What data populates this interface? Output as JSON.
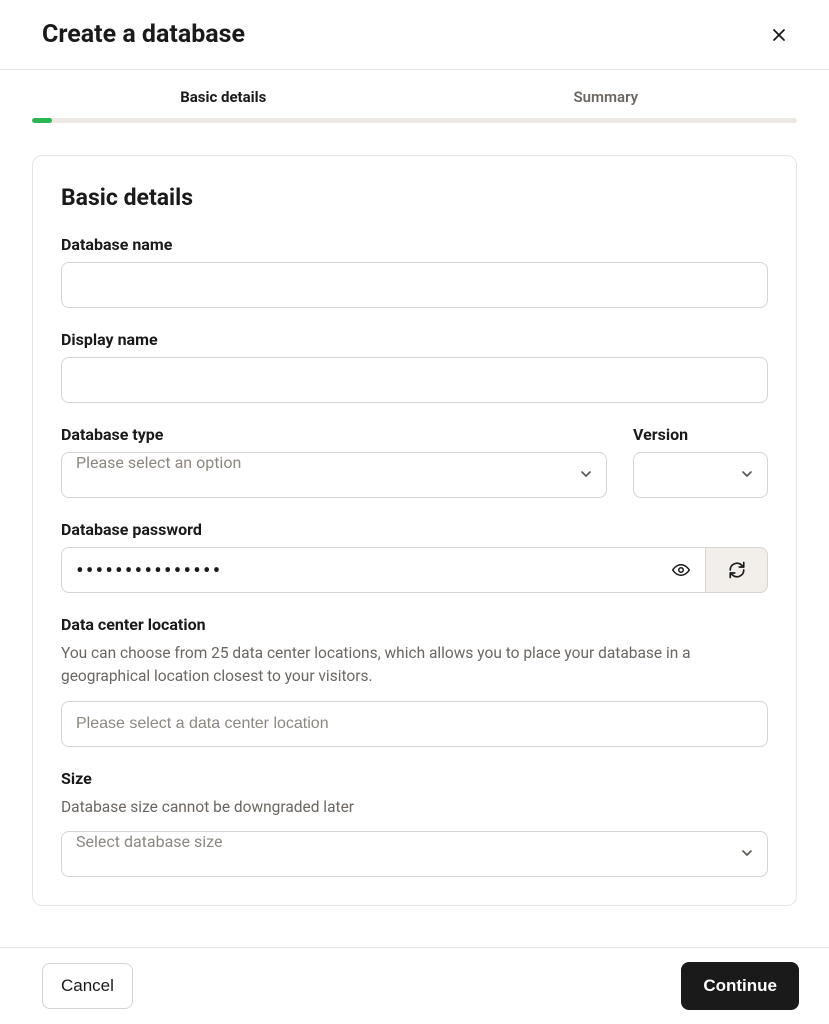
{
  "modal": {
    "title": "Create a database"
  },
  "tabs": {
    "basic": "Basic details",
    "summary": "Summary"
  },
  "section": {
    "title": "Basic details"
  },
  "fields": {
    "dbname": {
      "label": "Database name",
      "value": ""
    },
    "displayname": {
      "label": "Display name",
      "value": ""
    },
    "dbtype": {
      "label": "Database type",
      "placeholder": "Please select an option"
    },
    "version": {
      "label": "Version",
      "placeholder": ""
    },
    "password": {
      "label": "Database password",
      "value": "•••••••••••••••"
    },
    "location": {
      "label": "Data center location",
      "helper": "You can choose from 25 data center locations, which allows you to place your database in a geographical location closest to your visitors.",
      "placeholder": "Please select a data center location"
    },
    "size": {
      "label": "Size",
      "helper": "Database size cannot be downgraded later",
      "placeholder": "Select database size"
    }
  },
  "footer": {
    "cancel": "Cancel",
    "continue": "Continue"
  }
}
